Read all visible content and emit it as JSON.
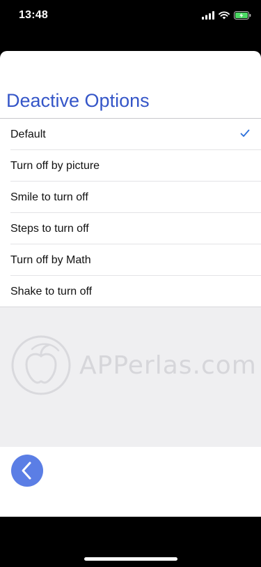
{
  "status_bar": {
    "time": "13:48",
    "icons": [
      "cellular-signal-icon",
      "wifi-icon",
      "battery-charging-icon"
    ]
  },
  "page": {
    "title": "Deactive Options"
  },
  "options": [
    {
      "label": "Default",
      "selected": true
    },
    {
      "label": "Turn off by picture",
      "selected": false
    },
    {
      "label": "Smile to turn off",
      "selected": false
    },
    {
      "label": "Steps to turn off",
      "selected": false
    },
    {
      "label": "Turn off by Math",
      "selected": false
    },
    {
      "label": "Shake to turn off",
      "selected": false
    }
  ],
  "watermark": {
    "text": "APPerlas.com",
    "icon": "apple-logo-icon"
  },
  "back_button": {
    "icon": "chevron-left-icon"
  },
  "colors": {
    "accent": "#3556c8",
    "check": "#2a6fdb",
    "back_button": "#5b7ee5",
    "battery": "#4cd964"
  }
}
